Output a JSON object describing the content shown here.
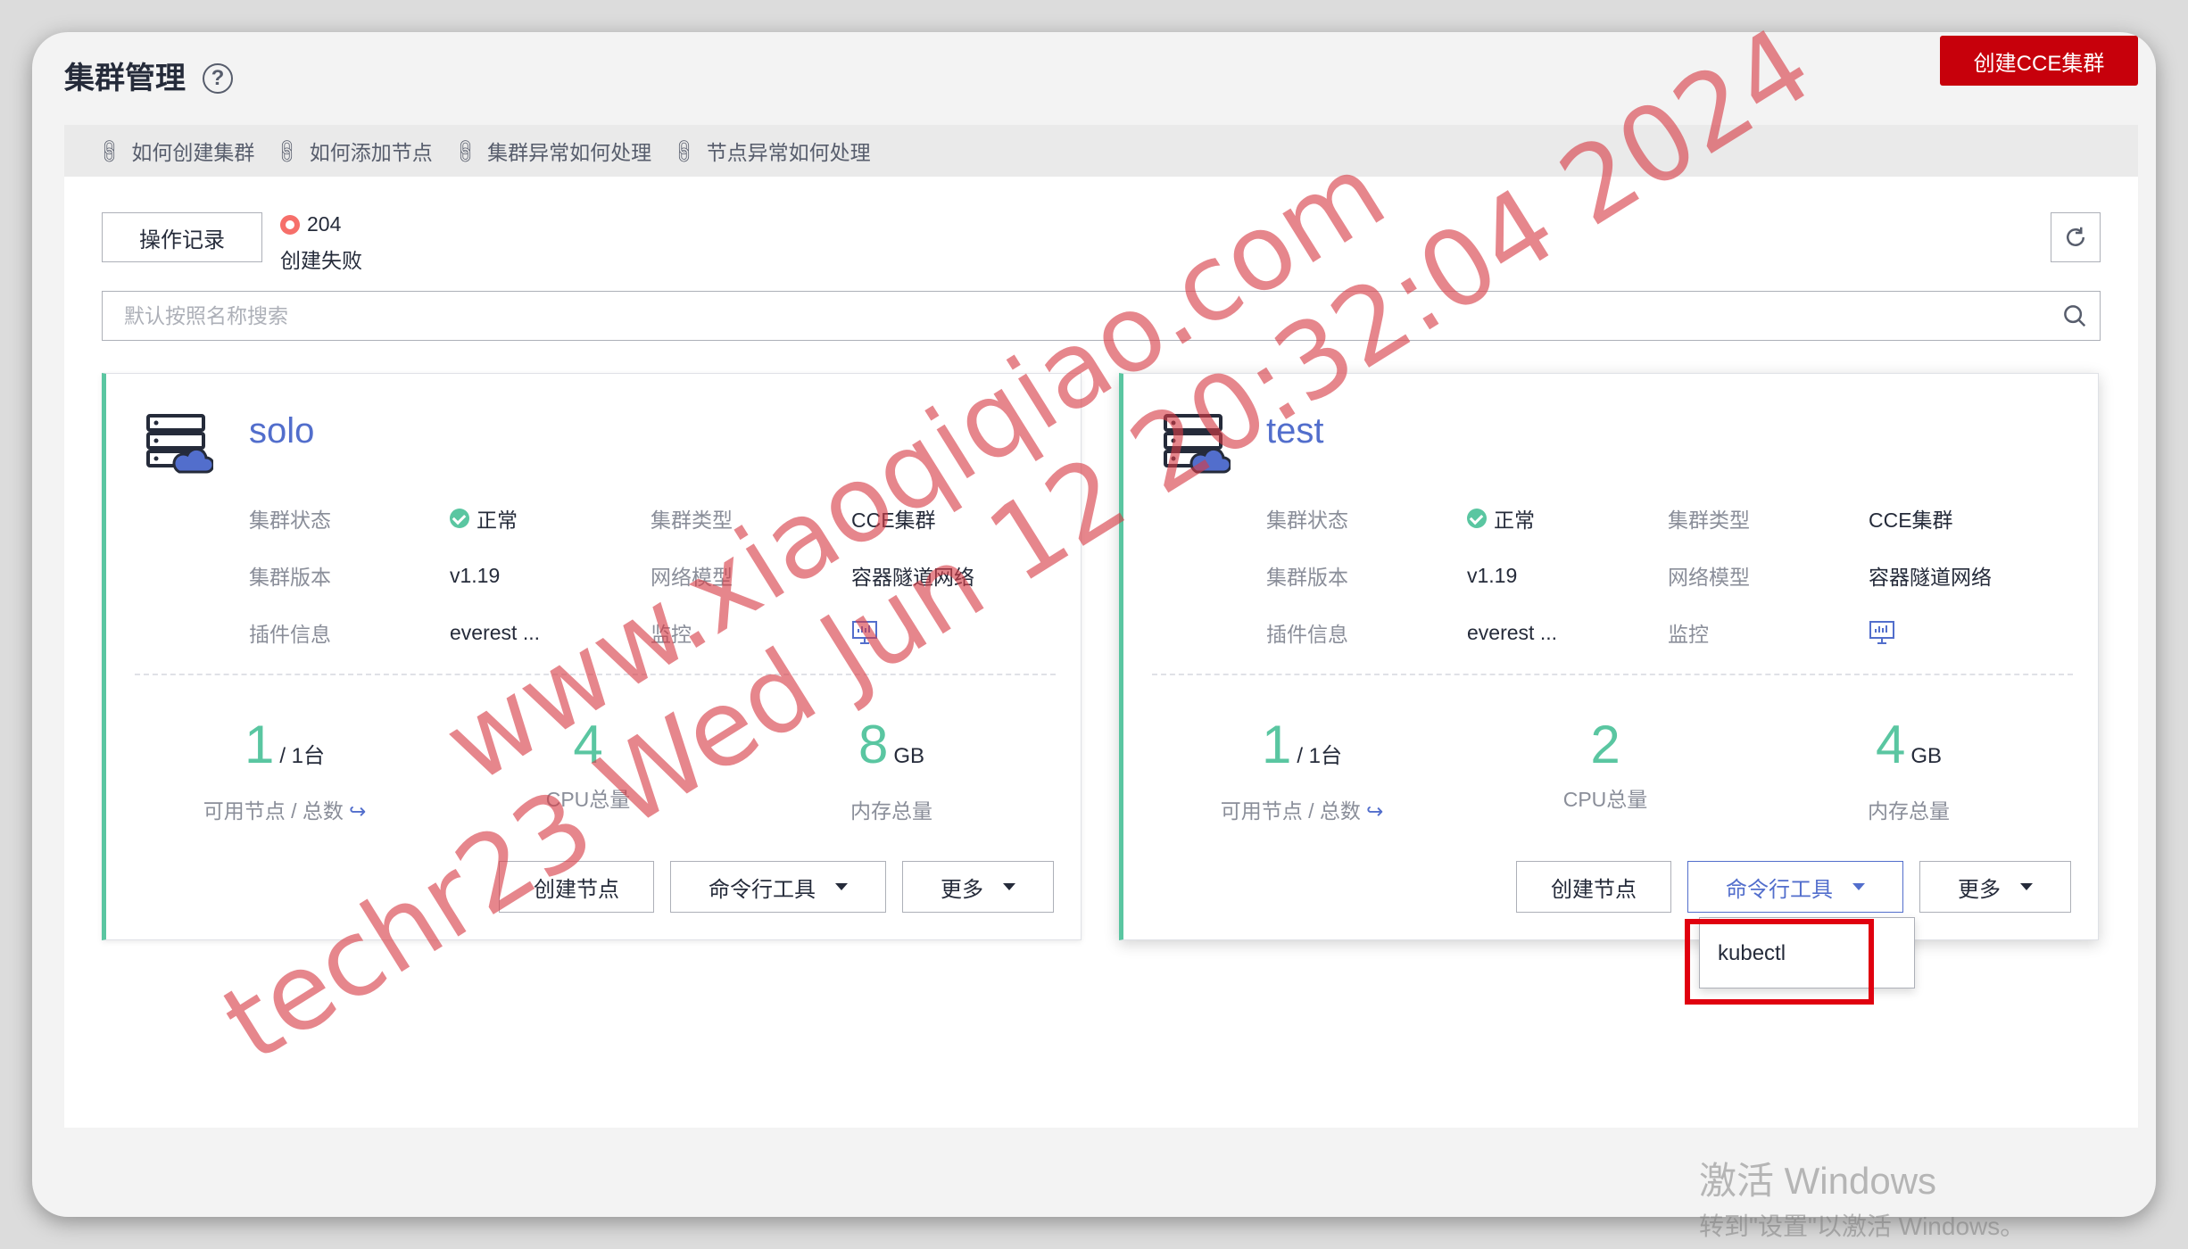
{
  "header": {
    "title": "集群管理",
    "help_icon": "?",
    "create_button": "创建CCE集群"
  },
  "help_links": [
    {
      "label": "如何创建集群",
      "icon": "link-icon"
    },
    {
      "label": "如何添加节点",
      "icon": "link-icon"
    },
    {
      "label": "集群异常如何处理",
      "icon": "link-icon"
    },
    {
      "label": "节点异常如何处理",
      "icon": "link-icon"
    }
  ],
  "toolbar": {
    "ops_record_button": "操作记录",
    "fail_count": "204",
    "fail_label": "创建失败",
    "refresh_icon": "refresh-icon"
  },
  "search": {
    "placeholder": "默认按照名称搜索",
    "value": ""
  },
  "labels": {
    "status": "集群状态",
    "type": "集群类型",
    "version": "集群版本",
    "network": "网络模型",
    "plugins": "插件信息",
    "monitor": "监控",
    "nodes": "可用节点 / 总数",
    "cpu": "CPU总量",
    "memory": "内存总量",
    "create_node": "创建节点",
    "cli_tools": "命令行工具",
    "more": "更多"
  },
  "clusters": [
    {
      "name": "solo",
      "status": "正常",
      "type": "CCE集群",
      "version": "v1.19",
      "network": "容器隧道网络",
      "plugins": "everest ...",
      "nodes_available": "1",
      "nodes_total": "/ 1台",
      "cpu": "4",
      "memory": "8",
      "memory_unit": "GB"
    },
    {
      "name": "test",
      "status": "正常",
      "type": "CCE集群",
      "version": "v1.19",
      "network": "容器隧道网络",
      "plugins": "everest ...",
      "nodes_available": "1",
      "nodes_total": "/ 1台",
      "cpu": "2",
      "memory": "4",
      "memory_unit": "GB"
    }
  ],
  "dropdown": {
    "items": [
      "kubectl"
    ]
  },
  "watermark": {
    "line1": "www.xiaoqiqiao.com",
    "line2": "techr23 Wed Jun 12 20:32:04 2024"
  },
  "os_overlay": {
    "line1": "激活 Windows",
    "line2": "转到\"设置\"以激活 Windows。"
  },
  "colors": {
    "brand_red": "#c7000b",
    "accent_green": "#5ac6a1",
    "link_blue": "#526ecc",
    "highlight_red": "#e0000f"
  }
}
